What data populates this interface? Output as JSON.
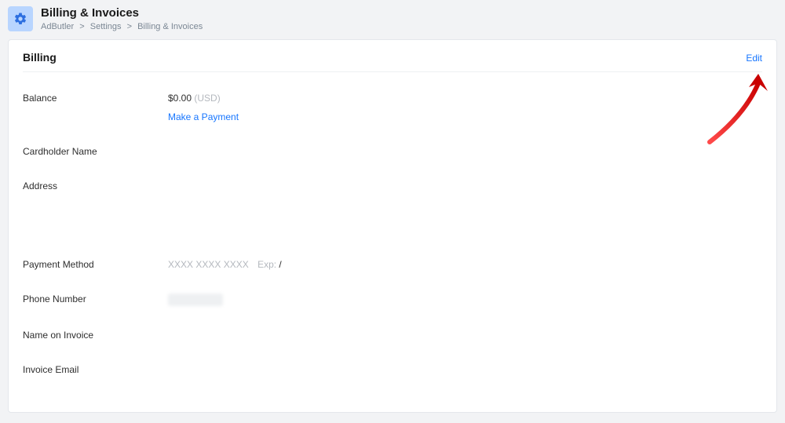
{
  "header": {
    "page_title": "Billing & Invoices",
    "breadcrumb": [
      "AdButler",
      "Settings",
      "Billing & Invoices"
    ]
  },
  "section": {
    "title": "Billing",
    "edit_label": "Edit"
  },
  "fields": {
    "balance_label": "Balance",
    "balance_value": "$0.00",
    "balance_currency": "(USD)",
    "make_payment_label": "Make a Payment",
    "cardholder_label": "Cardholder Name",
    "cardholder_value": "",
    "address_label": "Address",
    "address_value": "",
    "payment_method_label": "Payment Method",
    "payment_method_masked": "XXXX XXXX XXXX",
    "payment_method_exp_label": "Exp:",
    "payment_method_exp_value": "/",
    "phone_label": "Phone Number",
    "name_on_invoice_label": "Name on Invoice",
    "name_on_invoice_value": "",
    "invoice_email_label": "Invoice Email",
    "invoice_email_value": ""
  }
}
